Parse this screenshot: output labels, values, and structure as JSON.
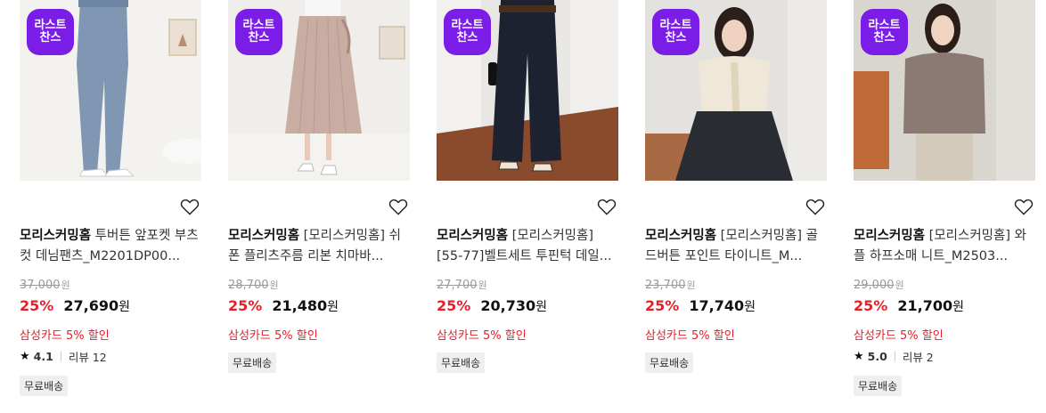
{
  "badge_text": "라스트\n찬스",
  "products": [
    {
      "brand": "모리스커밍홈",
      "name": "투버튼 앞포켓 부츠컷 데님팬츠_M2201DP00...",
      "original_price": "37,000",
      "discount": "25%",
      "price": "27,690",
      "won": "원",
      "card_promo": "삼성카드 5% 할인",
      "rating": "4.1",
      "review_label": "리뷰 12",
      "shipping": "무료배송",
      "colors": {
        "bg": "#f2f2f0",
        "item": "#7f97b3"
      }
    },
    {
      "brand": "모리스커밍홈",
      "name": "[모리스커밍홈] 쉬폰 플리츠주름 리본 치마바...",
      "original_price": "28,700",
      "discount": "25%",
      "price": "21,480",
      "won": "원",
      "card_promo": "삼성카드 5% 할인",
      "shipping": "무료배송",
      "colors": {
        "bg": "#efeeea",
        "item": "#c9ada3"
      }
    },
    {
      "brand": "모리스커밍홈",
      "name": "[모리스커밍홈] [55-77]벨트세트 투핀턱 데일...",
      "original_price": "27,700",
      "discount": "25%",
      "price": "20,730",
      "won": "원",
      "card_promo": "삼성카드 5% 할인",
      "shipping": "무료배송",
      "colors": {
        "bg": "#e7e6e2",
        "item": "#1d2230"
      }
    },
    {
      "brand": "모리스커밍홈",
      "name": "[모리스커밍홈] 골드버튼 포인트 타이니트_M...",
      "original_price": "23,700",
      "discount": "25%",
      "price": "17,740",
      "won": "원",
      "card_promo": "삼성카드 5% 할인",
      "shipping": "무료배송",
      "colors": {
        "bg": "#e4e2de",
        "item": "#2a2c33"
      }
    },
    {
      "brand": "모리스커밍홈",
      "name": "[모리스커밍홈] 와플 하프소매 니트_M2503...",
      "original_price": "29,000",
      "discount": "25%",
      "price": "21,700",
      "won": "원",
      "card_promo": "삼성카드 5% 할인",
      "rating": "5.0",
      "review_label": "리뷰 2",
      "shipping": "무료배송",
      "colors": {
        "bg": "#d9d5cf",
        "item": "#8a7a73"
      }
    }
  ]
}
